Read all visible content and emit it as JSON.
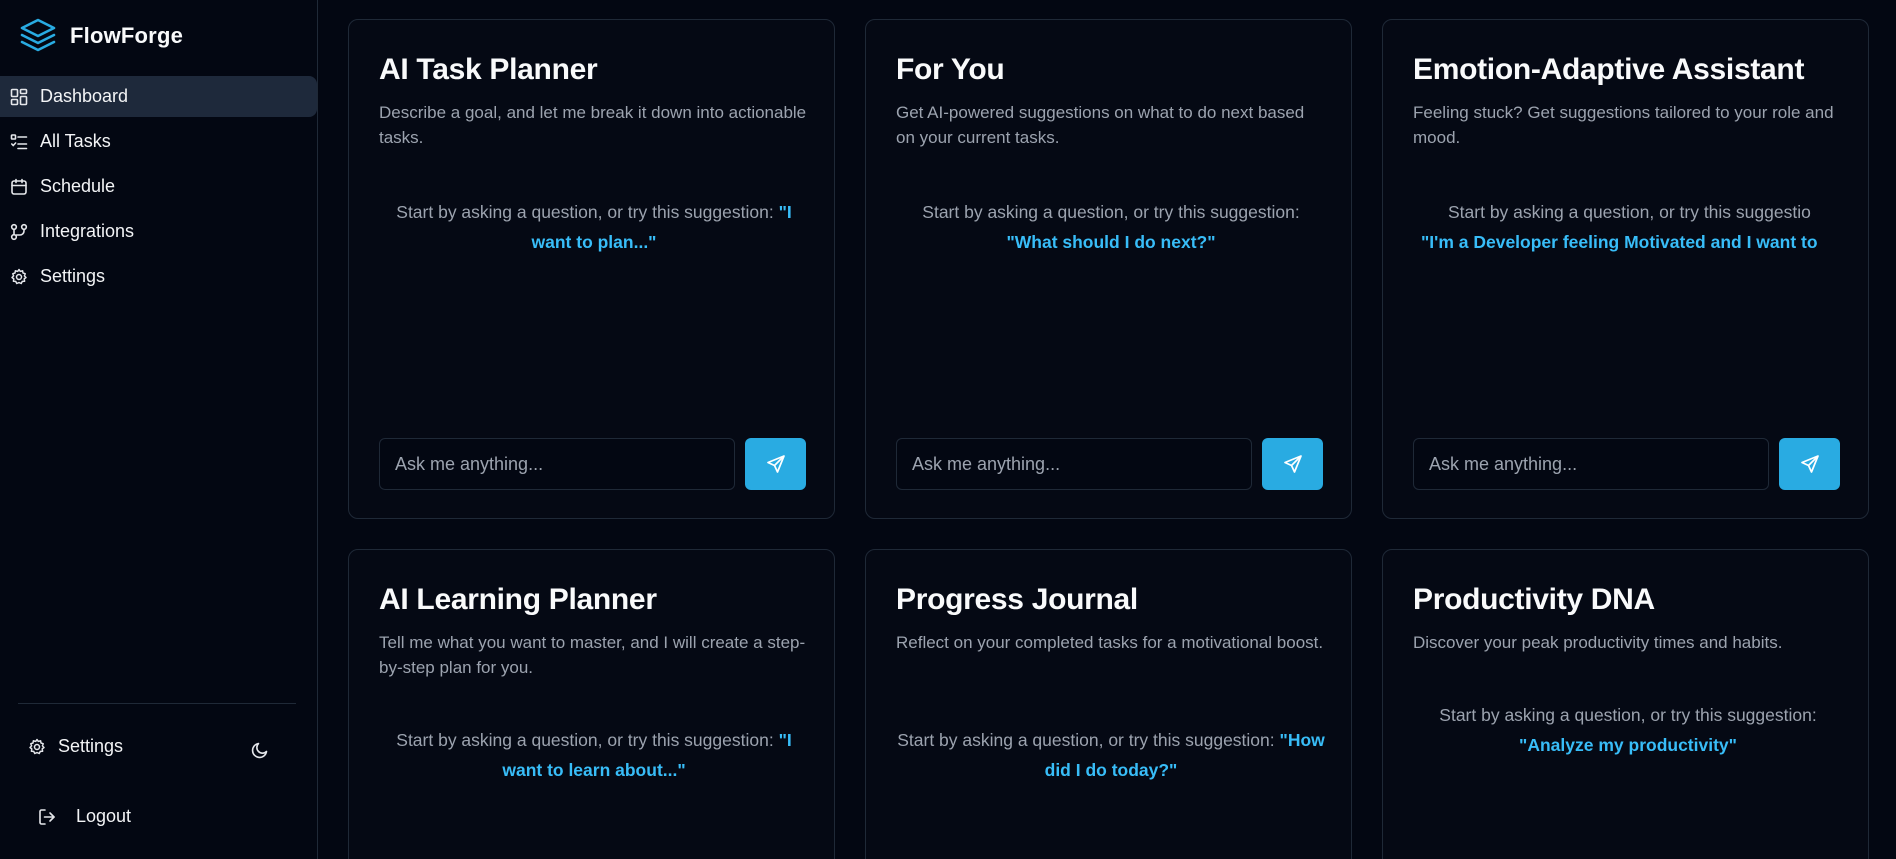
{
  "app": {
    "name": "FlowForge"
  },
  "sidebar": {
    "items": [
      {
        "label": "Dashboard",
        "icon": "dashboard-icon",
        "active": true
      },
      {
        "label": "All Tasks",
        "icon": "list-icon"
      },
      {
        "label": "Schedule",
        "icon": "calendar-icon"
      },
      {
        "label": "Integrations",
        "icon": "integrations-icon"
      },
      {
        "label": "Settings",
        "icon": "gear-icon"
      }
    ],
    "footer": {
      "settings_label": "Settings",
      "logout_label": "Logout",
      "theme_icon": "moon-icon"
    }
  },
  "cards": [
    {
      "title": "AI Task Planner",
      "description": "Describe a goal, and let me break it down into actionable tasks.",
      "suggestion_prefix": "Start by asking a question, or try this suggestion: ",
      "suggestion": "\"I want to plan...\"",
      "placeholder": "Ask me anything..."
    },
    {
      "title": "For You",
      "description": "Get AI-powered suggestions on what to do next based on your current tasks.",
      "suggestion_prefix": "Start by asking a question, or try this suggestion: ",
      "suggestion": "\"What should I do next?\"",
      "placeholder": "Ask me anything..."
    },
    {
      "title": "Emotion-Adaptive Assistant",
      "description": "Feeling stuck? Get suggestions tailored to your role and mood.",
      "suggestion_prefix": "Start by asking a question, or try this suggestio",
      "suggestion": "\"I'm a Developer feeling Motivated and I want to",
      "placeholder": "Ask me anything..."
    },
    {
      "title": "AI Learning Planner",
      "description": "Tell me what you want to master, and I will create a step-by-step plan for you.",
      "suggestion_prefix": "Start by asking a question, or try this suggestion: ",
      "suggestion": "\"I want to learn about...\""
    },
    {
      "title": "Progress Journal",
      "description": "Reflect on your completed tasks for a motivational boost.",
      "suggestion_prefix": "Start by asking a question, or try this suggestion: ",
      "suggestion": "\"How did I do today?\""
    },
    {
      "title": "Productivity DNA",
      "description": "Discover your peak productivity times and habits.",
      "suggestion_prefix": "Start by asking a question, or try this suggestion: ",
      "suggestion": "\"Analyze my productivity\""
    }
  ],
  "colors": {
    "background": "#030712",
    "accent": "#29abe2",
    "link": "#38bdf8",
    "active_nav": "#1e293b"
  }
}
